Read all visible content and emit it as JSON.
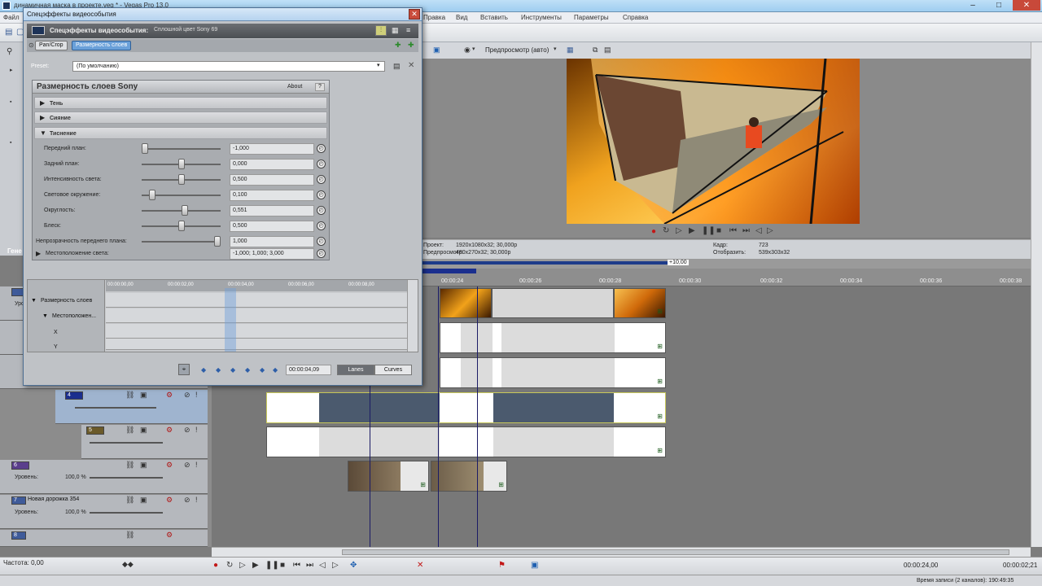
{
  "window": {
    "title": "динамичная маска в проекте.veg * - Vegas Pro 13.0",
    "minimize": "–",
    "maximize": "□",
    "close": "✕"
  },
  "menu": [
    "Файл",
    "Правка",
    "Вид",
    "Вставить",
    "Инструменты",
    "Параметры",
    "Справка"
  ],
  "preview": {
    "mode_label": "Предпросмотр (авто)",
    "project_label": "Проект:",
    "project_value": "1920x1080x32; 30,000p",
    "preview_label": "Предпросмотр:",
    "preview_value": "480x270x32; 30,000p",
    "frame_label": "Кадр:",
    "frame_value": "723",
    "display_label": "Отобразить:",
    "display_value": "539x303x32"
  },
  "timeline": {
    "marker_label": "+10,00",
    "ruler_ticks": [
      "00:00:24",
      "00:00:26",
      "00:00:28",
      "00:00:30",
      "00:00:32",
      "00:00:34",
      "00:00:36",
      "00:00:38"
    ],
    "tracks": [
      {
        "num": "",
        "level_label": "Уровень:",
        "level_value": "100,0 %"
      },
      {
        "num": "",
        "level_label": "",
        "level_value": ""
      },
      {
        "num": "",
        "level_label": "",
        "level_value": ""
      },
      {
        "num": "4",
        "level_label": "",
        "level_value": ""
      },
      {
        "num": "5",
        "level_label": "",
        "level_value": ""
      },
      {
        "num": "6",
        "level_label": "Уровень:",
        "level_value": "100,0 %"
      },
      {
        "num": "7",
        "name": "Новая дорожка 354",
        "level_label": "Уровень:",
        "level_value": "100,0 %"
      },
      {
        "num": "8",
        "level_label": "Уровень:",
        "level_value": "100,0 %"
      }
    ],
    "track0_label": "Уро"
  },
  "bottom": {
    "rate_label": "Частота: 0,00",
    "timecode": "00:00:24,00",
    "timecode2": "00:00:02;21"
  },
  "status": {
    "record_time": "Время записи (2 каналов): 190:49:35"
  },
  "left_panel": {
    "tag": "Гене"
  },
  "fx_dialog": {
    "title": "Спецэффекты видеособытия",
    "close": "✕",
    "header_title": "Спецэффекты видеособытия:",
    "header_sub": "Сплошной цвет Sony 69",
    "chain": [
      "Pan/Crop",
      "Размерность слоев"
    ],
    "preset_label": "Preset:",
    "preset_value": "(По умолчанию)",
    "plugin_title": "Размерность слоев Sony",
    "about": "About",
    "help": "?",
    "sections": [
      "Тень",
      "Сияние",
      "Тиснение"
    ],
    "params": [
      {
        "label": "Передний план:",
        "value": "-1,000",
        "pos": 0.0
      },
      {
        "label": "Задний план:",
        "value": "0,000",
        "pos": 0.5
      },
      {
        "label": "Интенсивность света:",
        "value": "0,500",
        "pos": 0.5
      },
      {
        "label": "Световое окружение:",
        "value": "0,100",
        "pos": 0.1
      },
      {
        "label": "Округлость:",
        "value": "0,551",
        "pos": 0.55
      },
      {
        "label": "Блеск:",
        "value": "0,500",
        "pos": 0.5
      },
      {
        "label": "Непрозрачность переднего плана:",
        "value": "1,000",
        "pos": 1.0
      }
    ],
    "light_pos_label": "Местоположение света:",
    "light_pos_value": "-1,000; 1,000; 3,000",
    "kf_ruler": [
      "00:00:00,00",
      "00:00:02,00",
      "00:00:04,00",
      "00:00:06,00",
      "00:00:08,00"
    ],
    "kf_tracks": [
      "Размерность слоев",
      "Местоположен...",
      "X",
      "Y"
    ],
    "kf_time": "00:00:04,09",
    "tab_lanes": "Lanes",
    "tab_curves": "Curves"
  },
  "colors": {
    "accent": "#6aa0d9",
    "clip_gold": "#d98b1a",
    "clip_slate": "#4b5a6e",
    "track_selected": "#9fb4cf"
  }
}
